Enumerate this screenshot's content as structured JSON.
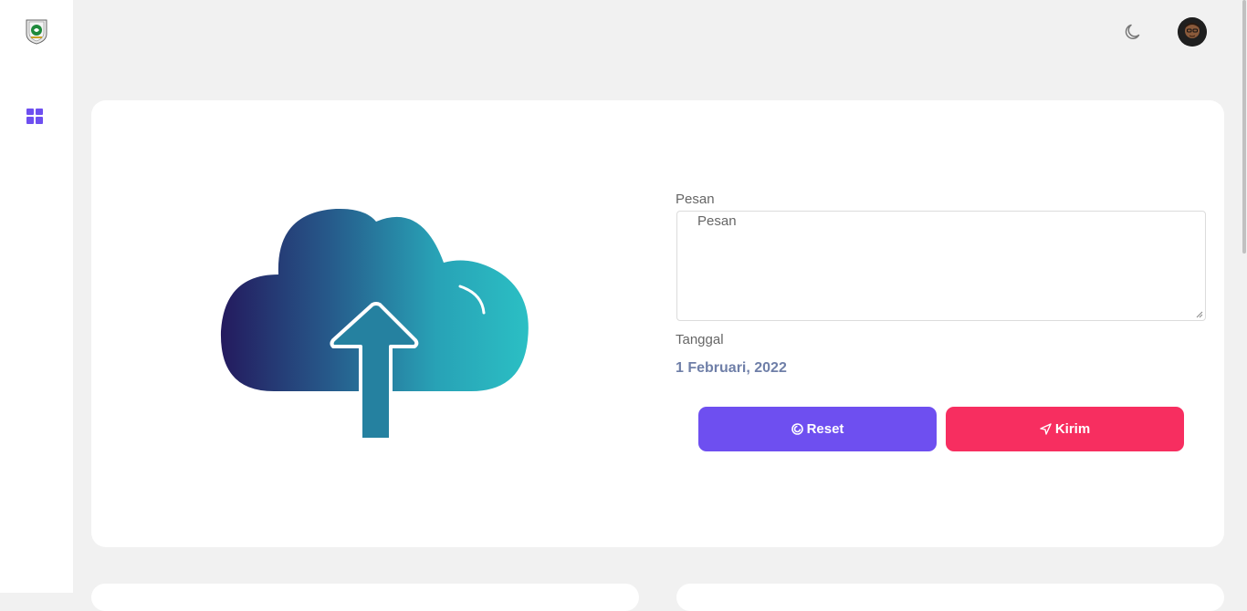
{
  "sidebar": {
    "logo_icon": "emblem-logo",
    "nav_icon": "dashboard-grid-icon",
    "accent": "#6e4ff0"
  },
  "topbar": {
    "theme_icon": "moon-icon",
    "avatar_icon": "user-avatar"
  },
  "form": {
    "message_label": "Pesan",
    "message_placeholder": "Pesan",
    "date_label": "Tanggal",
    "date_value": "1 Februari, 2022",
    "reset_label": "Reset",
    "send_label": "Kirim",
    "reset_color": "#6e4ff0",
    "send_color": "#f72e60"
  },
  "illustration": {
    "icon": "cloud-upload-icon"
  }
}
